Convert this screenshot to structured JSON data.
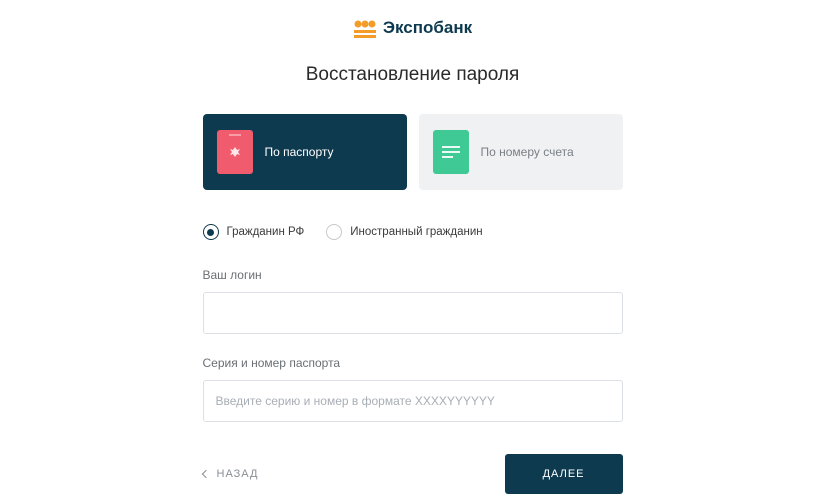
{
  "logo": {
    "text": "Экспобанк"
  },
  "page": {
    "title": "Восстановление пароля"
  },
  "methods": {
    "passport": {
      "label": "По паспорту"
    },
    "account": {
      "label": "По номеру счета"
    }
  },
  "citizenship": {
    "rf": {
      "label": "Гражданин РФ"
    },
    "foreign": {
      "label": "Иностранный гражданин"
    }
  },
  "fields": {
    "login": {
      "label": "Ваш логин",
      "value": ""
    },
    "passport": {
      "label": "Серия и номер паспорта",
      "placeholder": "Введите серию и номер в формате XXXXYYYYYY"
    }
  },
  "actions": {
    "back": "НАЗАД",
    "next": "ДАЛЕЕ"
  },
  "colors": {
    "primary": "#0e3a4f",
    "accent_orange": "#f39c2a",
    "passport_red": "#f05c6e",
    "account_green": "#3fc995"
  }
}
